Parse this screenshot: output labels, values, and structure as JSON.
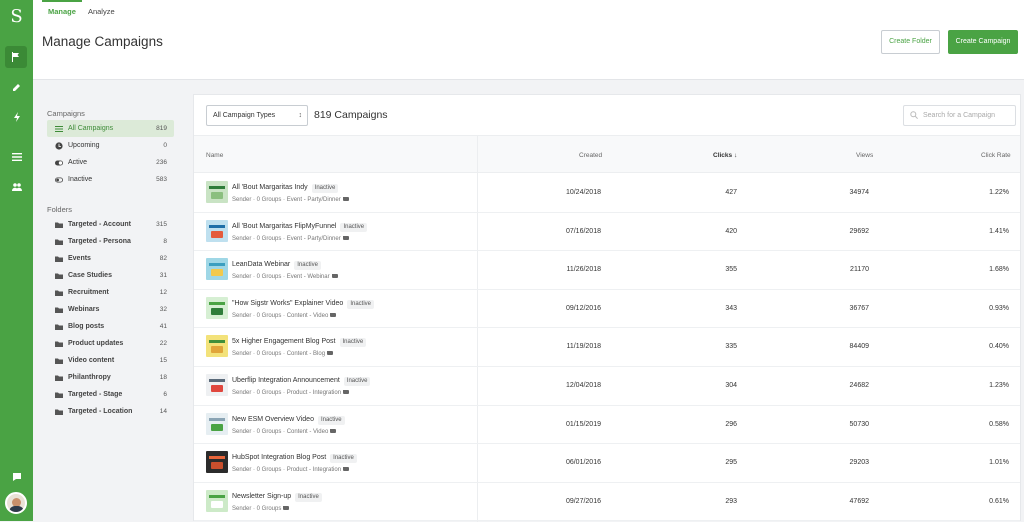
{
  "app": {
    "logo": "S"
  },
  "tabs": [
    {
      "label": "Manage"
    },
    {
      "label": "Analyze"
    }
  ],
  "header": {
    "title": "Manage Campaigns",
    "create_folder_label": "Create Folder",
    "create_campaign_label": "Create Campaign"
  },
  "sidebar": {
    "campaigns_heading": "Campaigns",
    "campaigns": [
      {
        "label": "All Campaigns",
        "count": "819",
        "icon": "list-icon"
      },
      {
        "label": "Upcoming",
        "count": "0",
        "icon": "clock-icon"
      },
      {
        "label": "Active",
        "count": "236",
        "icon": "toggle-on-icon"
      },
      {
        "label": "Inactive",
        "count": "583",
        "icon": "toggle-off-icon"
      }
    ],
    "folders_heading": "Folders",
    "folders": [
      {
        "label": "Targeted - Account",
        "count": "315"
      },
      {
        "label": "Targeted - Persona",
        "count": "8"
      },
      {
        "label": "Events",
        "count": "82"
      },
      {
        "label": "Case Studies",
        "count": "31"
      },
      {
        "label": "Recruitment",
        "count": "12"
      },
      {
        "label": "Webinars",
        "count": "32"
      },
      {
        "label": "Blog posts",
        "count": "41"
      },
      {
        "label": "Product updates",
        "count": "22"
      },
      {
        "label": "Video content",
        "count": "15"
      },
      {
        "label": "Philanthropy",
        "count": "18"
      },
      {
        "label": "Targeted - Stage",
        "count": "6"
      },
      {
        "label": "Targeted - Location",
        "count": "14"
      }
    ]
  },
  "toolbar": {
    "type_select": "All Campaign Types",
    "campaign_count": "819 Campaigns",
    "search_placeholder": "Search for a Campaign"
  },
  "table": {
    "headers": {
      "name": "Name",
      "created": "Created",
      "clicks": "Clicks ↓",
      "views": "Views",
      "click_rate": "Click Rate"
    },
    "rows": [
      {
        "title": "All 'Bout Margaritas Indy",
        "status": "Inactive",
        "meta": "Sender  ·  0 Groups  ·  Event - Party/Dinner",
        "created": "10/24/2018",
        "clicks": "427",
        "views": "34974",
        "rate": "1.22%",
        "thumb": [
          "#c9e3c4",
          "#2f7d3a",
          "#8bbf7f"
        ]
      },
      {
        "title": "All 'Bout Margaritas FlipMyFunnel",
        "status": "Inactive",
        "meta": "Sender  ·  0 Groups  ·  Event - Party/Dinner",
        "created": "07/16/2018",
        "clicks": "420",
        "views": "29692",
        "rate": "1.41%",
        "thumb": [
          "#bfe0ef",
          "#1f6fa8",
          "#e45b3c"
        ]
      },
      {
        "title": "LeanData Webinar",
        "status": "Inactive",
        "meta": "Sender  ·  0 Groups  ·  Event - Webinar",
        "created": "11/26/2018",
        "clicks": "355",
        "views": "21170",
        "rate": "1.68%",
        "thumb": [
          "#9fd7e6",
          "#3b9fc0",
          "#f2c94c"
        ]
      },
      {
        "title": "\"How Sigstr Works\" Explainer Video",
        "status": "Inactive",
        "meta": "Sender  ·  0 Groups  ·  Content - Video",
        "created": "09/12/2016",
        "clicks": "343",
        "views": "36767",
        "rate": "0.93%",
        "thumb": [
          "#d6efd3",
          "#4aa344",
          "#2f7d3a"
        ]
      },
      {
        "title": "5x Higher Engagement Blog Post",
        "status": "Inactive",
        "meta": "Sender  ·  0 Groups  ·  Content - Blog",
        "created": "11/19/2018",
        "clicks": "335",
        "views": "84409",
        "rate": "0.40%",
        "thumb": [
          "#f3e27a",
          "#3f8f3a",
          "#e0a53a"
        ]
      },
      {
        "title": "Uberflip Integration Announcement",
        "status": "Inactive",
        "meta": "Sender  ·  0 Groups  ·  Product - Integration",
        "created": "12/04/2018",
        "clicks": "304",
        "views": "24682",
        "rate": "1.23%",
        "thumb": [
          "#eef0f2",
          "#5a6a7a",
          "#e0473e"
        ]
      },
      {
        "title": "New ESM Overview Video",
        "status": "Inactive",
        "meta": "Sender  ·  0 Groups  ·  Content - Video",
        "created": "01/15/2019",
        "clicks": "296",
        "views": "50730",
        "rate": "0.58%",
        "thumb": [
          "#e6eef2",
          "#8aa4b4",
          "#4aa344"
        ]
      },
      {
        "title": "HubSpot Integration Blog Post",
        "status": "Inactive",
        "meta": "Sender  ·  0 Groups  ·  Product - Integration",
        "created": "06/01/2016",
        "clicks": "295",
        "views": "29203",
        "rate": "1.01%",
        "thumb": [
          "#2b2b2b",
          "#e8653a",
          "#c94f2d"
        ]
      },
      {
        "title": "Newsletter Sign-up",
        "status": "Inactive",
        "meta": "Sender  ·  0 Groups",
        "created": "09/27/2016",
        "clicks": "293",
        "views": "47692",
        "rate": "0.61%",
        "thumb": [
          "#cdeac8",
          "#4aa344",
          "#ffffff"
        ]
      }
    ]
  },
  "colors": {
    "brand": "#4aa344",
    "rail": "#4aa344",
    "active_bg": "#dcead8"
  }
}
